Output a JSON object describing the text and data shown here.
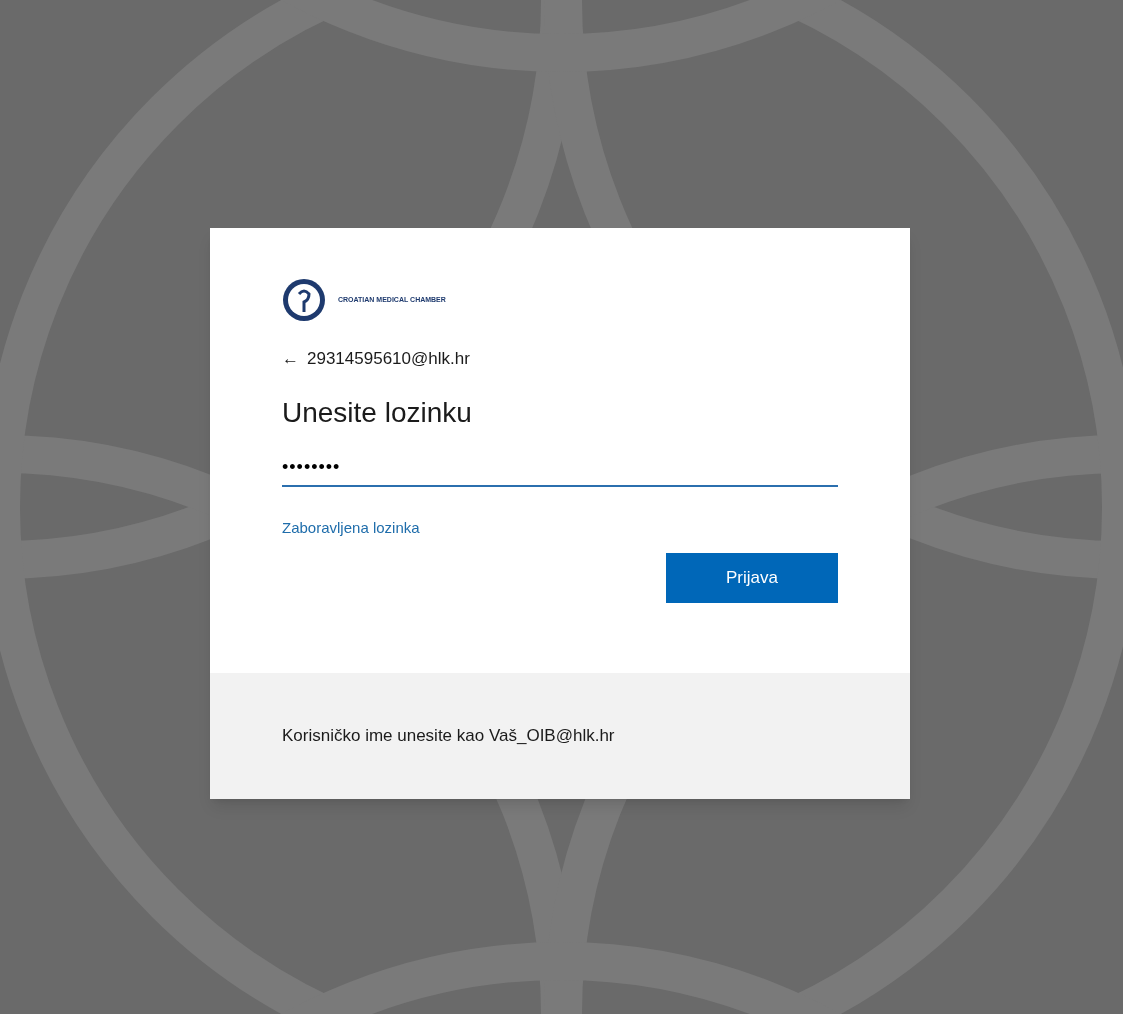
{
  "logo": {
    "text": "CROATIAN MEDICAL CHAMBER"
  },
  "back": {
    "icon": "←",
    "account": "29314595610@hlk.hr"
  },
  "title": "Unesite lozinku",
  "password": {
    "value": "••••••••"
  },
  "forgot_link": "Zaboravljena lozinka",
  "submit_button": "Prijava",
  "footer": "Korisničko ime unesite kao Vaš_OIB@hlk.hr"
}
